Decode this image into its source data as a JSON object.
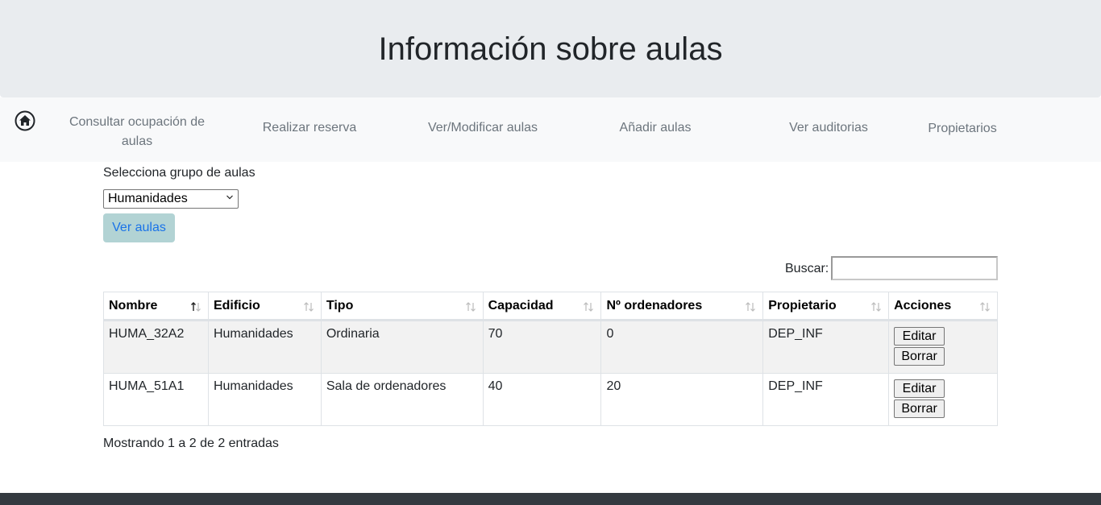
{
  "header": {
    "title": "Información sobre aulas"
  },
  "nav": {
    "home_icon": "home-icon",
    "items": [
      {
        "label": "Consultar ocupación de aulas"
      },
      {
        "label": "Realizar reserva"
      },
      {
        "label": "Ver/Modificar aulas"
      },
      {
        "label": "Añadir aulas"
      },
      {
        "label": "Ver auditorias"
      },
      {
        "label": "Propietarios"
      }
    ]
  },
  "form": {
    "group_label": "Selecciona grupo de aulas",
    "group_selected": "Humanidades",
    "ver_button": "Ver aulas"
  },
  "search": {
    "label": "Buscar:",
    "value": ""
  },
  "table": {
    "columns": [
      "Nombre",
      "Edificio",
      "Tipo",
      "Capacidad",
      "Nº ordenadores",
      "Propietario",
      "Acciones"
    ],
    "rows": [
      {
        "nombre": "HUMA_32A2",
        "edificio": "Humanidades",
        "tipo": "Ordinaria",
        "capacidad": "70",
        "ordenadores": "0",
        "propietario": "DEP_INF",
        "edit": "Editar",
        "delete": "Borrar"
      },
      {
        "nombre": "HUMA_51A1",
        "edificio": "Humanidades",
        "tipo": "Sala de ordenadores",
        "capacidad": "40",
        "ordenadores": "20",
        "propietario": "DEP_INF",
        "edit": "Editar",
        "delete": "Borrar"
      }
    ]
  },
  "info": "Mostrando 1 a 2 de 2 entradas",
  "colors": {
    "header_bg": "#e9ecef",
    "nav_bg": "#f8f9fa",
    "button_bg": "#b2d3d4",
    "link": "#1a73e8",
    "footer_bg": "#343a40"
  }
}
